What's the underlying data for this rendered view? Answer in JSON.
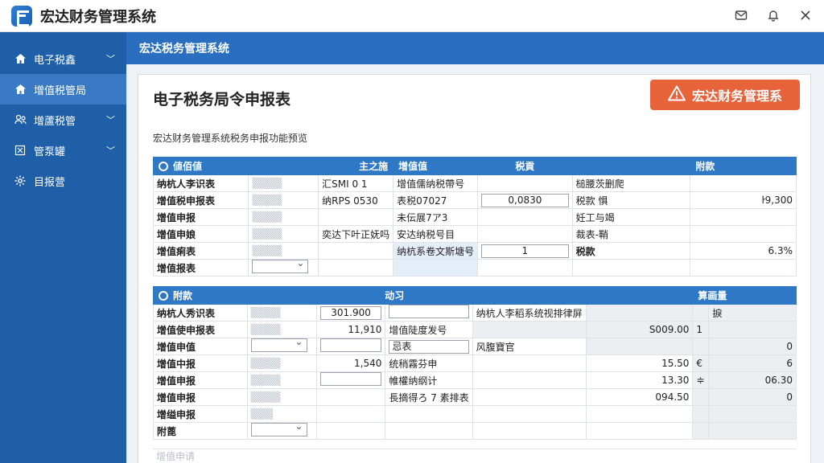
{
  "app": {
    "title": "宏达财务管理系统"
  },
  "window": {
    "icons": [
      "mail-icon",
      "bell-icon",
      "close-icon"
    ]
  },
  "sidebar": {
    "items": [
      {
        "label": "电子税鑫",
        "icon": "home-icon",
        "expandable": true,
        "active": false
      },
      {
        "label": "增值税管局",
        "icon": "home-icon",
        "expandable": false,
        "active": true
      },
      {
        "label": "增蘆税管",
        "icon": "people-icon",
        "expandable": true,
        "active": false
      },
      {
        "label": "管泵罐",
        "icon": "document-icon",
        "expandable": true,
        "active": false
      },
      {
        "label": "目报营",
        "icon": "gear-icon",
        "expandable": false,
        "active": false
      }
    ]
  },
  "header": {
    "title": "宏达税务管理系统"
  },
  "panel": {
    "title": "电子税务局令申报表",
    "brand_button": "宏达财务管理系",
    "subtitle": "宏达财务管理系统税务申报功能预览"
  },
  "table1": {
    "headers": [
      "値佰値",
      "主之施",
      "增值值",
      "税貢",
      "附款"
    ],
    "rows": [
      [
        "纳杭人李识表",
        "",
        "汇SMI 0 1",
        "增值儒纳税帶号",
        "",
        "槌腰茨删爬",
        ""
      ],
      [
        "增值税申报表",
        "",
        "纳RPS 0530",
        "表税07027",
        "0,0830",
        "税款 惧",
        "ŀ9,300"
      ],
      [
        "增值申报",
        "",
        "",
        "未伝展7ア3",
        "",
        "妊工与竭",
        ""
      ],
      [
        "增值申娘",
        "",
        "奕达下叶正妩吗",
        "安达纳税号目",
        "",
        "裁表-鞘",
        ""
      ],
      [
        "增值痢表",
        "",
        "",
        "纳杭系卷文斯塘号",
        "1",
        "税款",
        "6.3%"
      ],
      [
        "增值报表",
        "",
        "",
        "",
        "",
        "",
        ""
      ]
    ]
  },
  "table2": {
    "headers": [
      "附款",
      "动习",
      "算画量"
    ],
    "rows": [
      [
        "纳杭人秀识表",
        "",
        "301.900",
        "",
        "纳杭人李稻系统视排律屏",
        "",
        "",
        "捩"
      ],
      [
        "增值使申报表",
        "",
        "11,910",
        "增值陡度发号",
        "",
        "S009.00",
        "1",
        ""
      ],
      [
        "增值申值",
        "",
        "",
        "忌表",
        "风腹寶官",
        "",
        "",
        "0"
      ],
      [
        "增值中报",
        "",
        "1,540",
        "统稍霧芬申",
        "",
        "15.50",
        "€",
        "6"
      ],
      [
        "增值申报",
        "",
        "",
        "帷權纳纲计",
        "",
        "13.30",
        "≑",
        "06.30"
      ],
      [
        "增值申报",
        "",
        "",
        "長摘得ろ 7 素排表",
        "",
        "094.50",
        "",
        "0"
      ],
      [
        "增缢申报",
        "",
        "",
        "",
        "",
        "",
        "",
        ""
      ],
      [
        "附蓖",
        "",
        "",
        "",
        "",
        "",
        "",
        ""
      ]
    ],
    "bottom_row": "增值申请"
  }
}
